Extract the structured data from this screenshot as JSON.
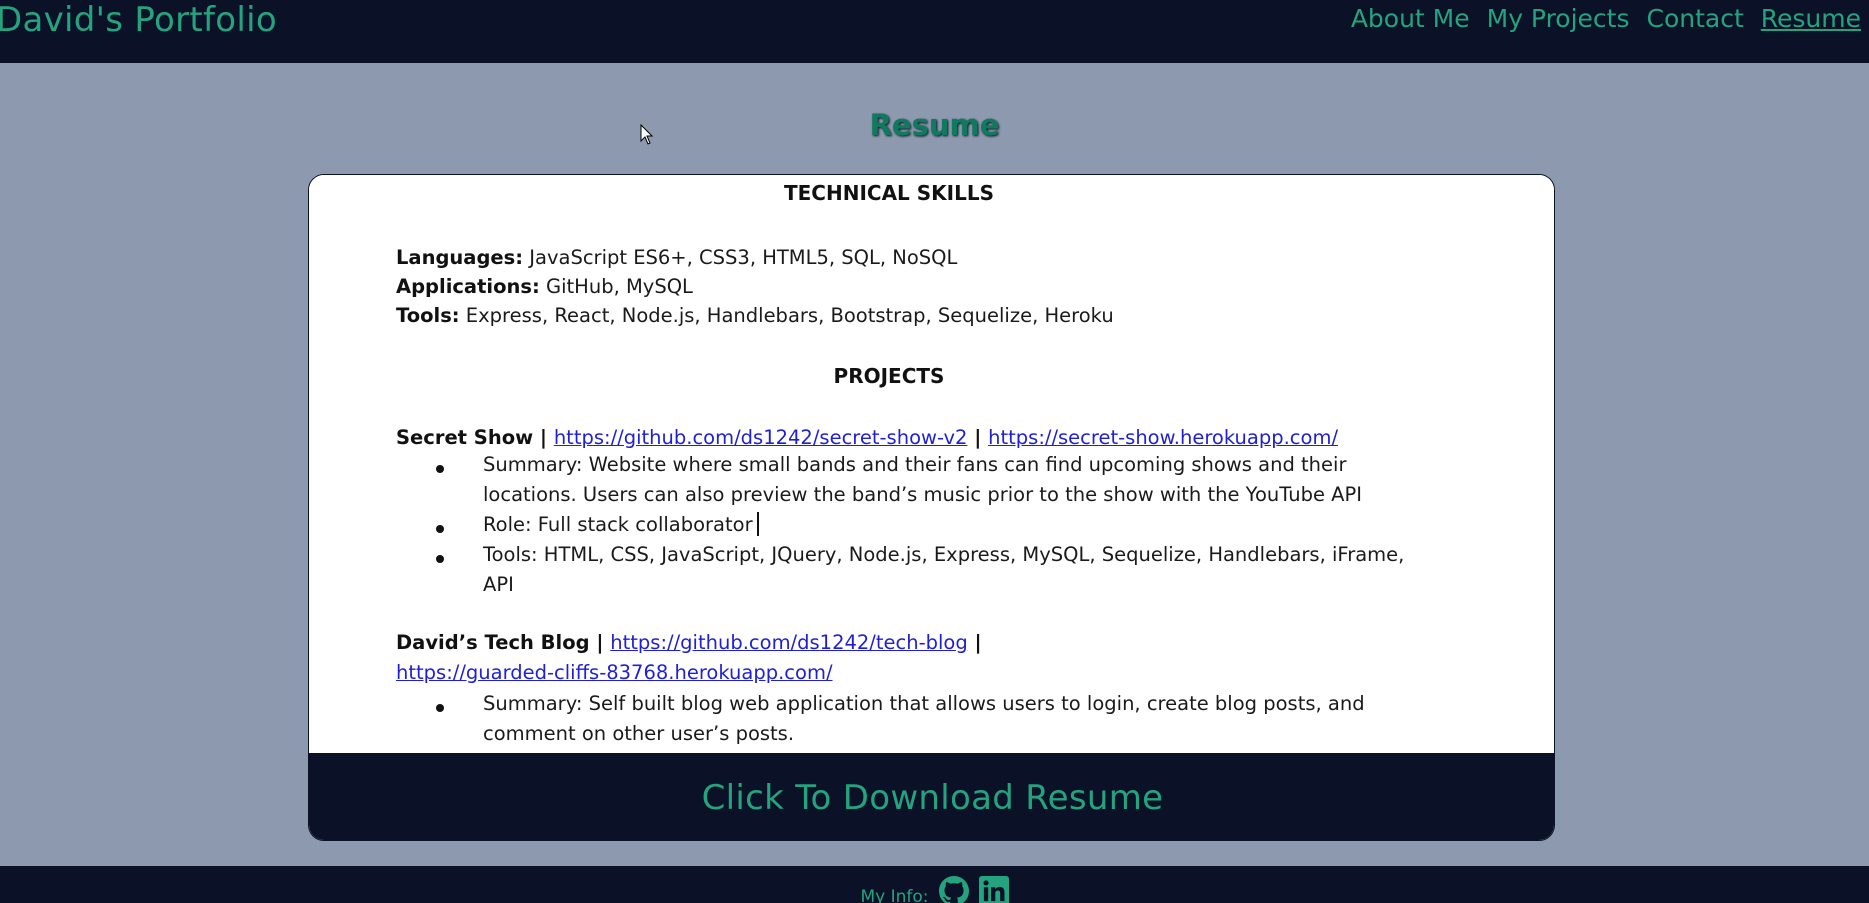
{
  "navbar": {
    "brand": "David's Portfolio",
    "links": [
      {
        "label": "About Me"
      },
      {
        "label": "My Projects"
      },
      {
        "label": "Contact"
      },
      {
        "label": "Resume",
        "active": true
      }
    ]
  },
  "page": {
    "title": "Resume"
  },
  "resume": {
    "technical_skills_heading": "TECHNICAL SKILLS",
    "skills": [
      {
        "label": "Languages:",
        "value": " JavaScript ES6+, CSS3, HTML5, SQL, NoSQL"
      },
      {
        "label": "Applications:",
        "value": " GitHub, MySQL"
      },
      {
        "label": "Tools:",
        "value": " Express, React, Node.js, Handlebars, Bootstrap, Sequelize, Heroku"
      }
    ],
    "projects_heading": "PROJECTS",
    "projects": [
      {
        "name": "Secret Show",
        "separator": " | ",
        "link1": "https://github.com/ds1242/secret-show-v2",
        "link2": "https://secret-show.herokuapp.com/",
        "bullets": [
          "Summary: Website where small bands and their fans can find upcoming shows and their locations. Users can also preview the band’s music prior to the show with the YouTube API",
          "Role: Full stack collaborator",
          "Tools: HTML, CSS, JavaScript, JQuery, Node.js, Express, MySQL, Sequelize, Handlebars, iFrame, API"
        ]
      },
      {
        "name": "David’s Tech Blog",
        "separator": " | ",
        "link1": "https://github.com/ds1242/tech-blog",
        "link2": "https://guarded-cliffs-83768.herokuapp.com/",
        "bullets": [
          "Summary: Self built blog web application that allows users to login, create blog posts, and comment on other user’s posts."
        ]
      }
    ]
  },
  "download": {
    "label": "Click To Download Resume"
  },
  "footer": {
    "label": "My Info:",
    "icons": [
      "github-icon",
      "linkedin-icon"
    ]
  },
  "colors": {
    "accent": "#23a47f",
    "dark": "#0b1227",
    "background": "#8d99ae",
    "link": "#1f1fd6"
  }
}
